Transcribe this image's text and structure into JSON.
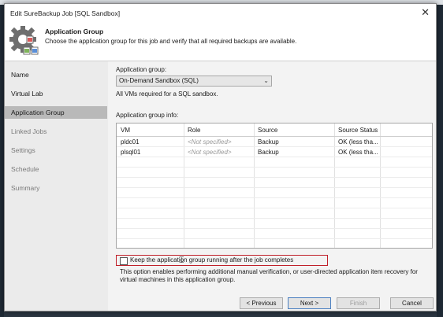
{
  "window": {
    "title": "Edit SureBackup Job [SQL Sandbox]"
  },
  "banner": {
    "title": "Application Group",
    "description": "Choose the application group for this job and verify that all required backups are available."
  },
  "nav": {
    "items": [
      {
        "label": "Name",
        "state": "normal"
      },
      {
        "label": "Virtual Lab",
        "state": "normal"
      },
      {
        "label": "Application Group",
        "state": "active"
      },
      {
        "label": "Linked Jobs",
        "state": "disabled"
      },
      {
        "label": "Settings",
        "state": "disabled"
      },
      {
        "label": "Schedule",
        "state": "disabled"
      },
      {
        "label": "Summary",
        "state": "disabled"
      }
    ]
  },
  "form": {
    "app_group_label": "Application group:",
    "app_group_value": "On-Demand Sandbox (SQL)",
    "app_group_note": "All VMs required for a SQL sandbox.",
    "info_label": "Application group info:"
  },
  "grid": {
    "columns": [
      "VM",
      "Role",
      "Source",
      "Source Status"
    ],
    "rows": [
      [
        "pldc01",
        "<Not specified>",
        "Backup",
        "OK (less tha..."
      ],
      [
        "plsql01",
        "<Not specified>",
        "Backup",
        "OK (less tha..."
      ]
    ]
  },
  "keep_running": {
    "label": "Keep the application group running after the job completes",
    "checked": false,
    "description": "This option enables performing additional manual verification, or user-directed application item recovery for virtual machines in this application group."
  },
  "buttons": {
    "previous": "< Previous",
    "next": "Next >",
    "finish": "Finish",
    "cancel": "Cancel"
  },
  "colors": {
    "highlight_border": "#c0202a",
    "active_nav": "#b9b9b9"
  },
  "icons": {
    "banner": "gear-backup-icon",
    "close": "close-icon",
    "dropdown": "chevron-down-icon"
  }
}
